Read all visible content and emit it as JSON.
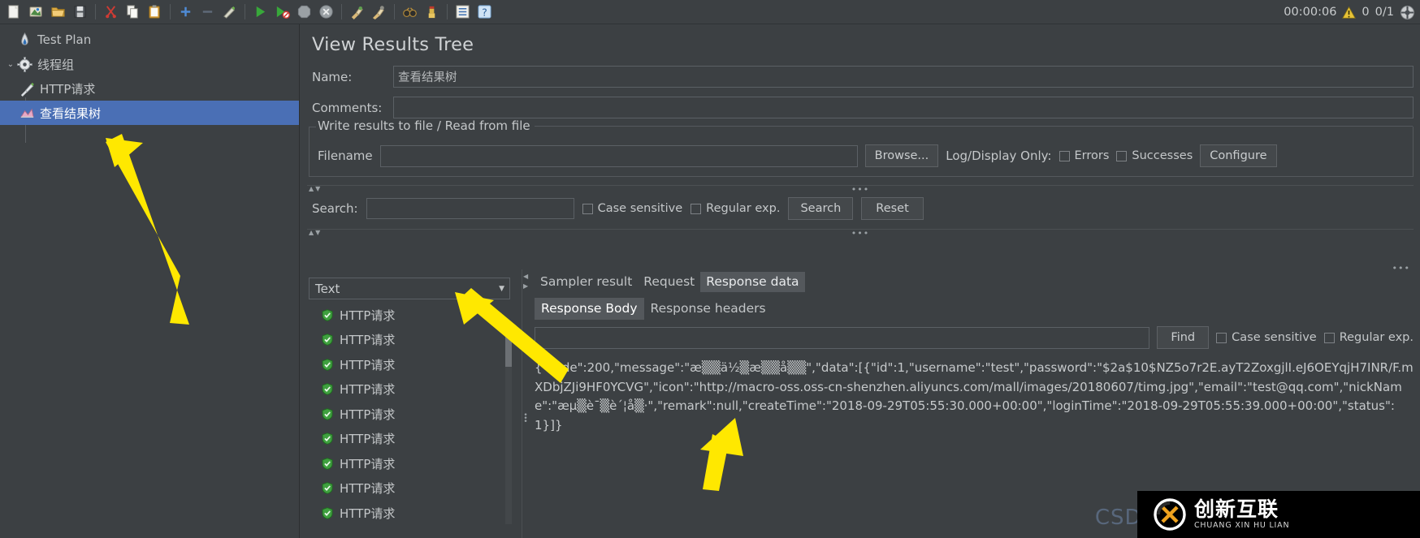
{
  "toolbar": {
    "buttons": [
      {
        "name": "new-icon",
        "glyph": "📄",
        "title": "New"
      },
      {
        "name": "templates-icon",
        "glyph": "🗂",
        "title": "Templates"
      },
      {
        "name": "open-icon",
        "glyph": "📂",
        "title": "Open"
      },
      {
        "name": "save-icon",
        "glyph": "💾",
        "title": "Save"
      },
      {
        "name": "cut-icon",
        "glyph": "✂",
        "title": "Cut"
      },
      {
        "name": "copy-icon",
        "glyph": "📋",
        "title": "Copy"
      },
      {
        "name": "paste-icon",
        "glyph": "📋",
        "title": "Paste"
      },
      {
        "name": "expand-all-icon",
        "glyph": "+",
        "title": "Expand All"
      },
      {
        "name": "collapse-all-icon",
        "glyph": "−",
        "title": "Collapse All"
      },
      {
        "name": "toggle-icon",
        "glyph": "✎",
        "title": "Toggle"
      },
      {
        "name": "start-icon",
        "glyph": "▶",
        "title": "Start"
      },
      {
        "name": "start-no-pauses-icon",
        "glyph": "▶",
        "title": "Start no pauses"
      },
      {
        "name": "stop-icon",
        "glyph": "⬣",
        "title": "Stop"
      },
      {
        "name": "shutdown-icon",
        "glyph": "✕",
        "title": "Shutdown"
      },
      {
        "name": "clear-icon",
        "glyph": "🧹",
        "title": "Clear"
      },
      {
        "name": "clear-all-icon",
        "glyph": "🧹",
        "title": "Clear All"
      },
      {
        "name": "search-icon",
        "glyph": "🔍",
        "title": "Search"
      },
      {
        "name": "search-reset-icon",
        "glyph": "🧹",
        "title": "Reset Search"
      },
      {
        "name": "function-helper-icon",
        "glyph": "≡",
        "title": "Function Helper"
      },
      {
        "name": "help-icon",
        "glyph": "?",
        "title": "Help"
      }
    ]
  },
  "status": {
    "elapsed": "00:00:06",
    "warnings": "0",
    "threads": "0/1"
  },
  "tree": {
    "nodes": [
      {
        "label": "Test Plan",
        "icon": "test-plan-icon",
        "level": 1,
        "selected": false,
        "twisty": ""
      },
      {
        "label": "线程组",
        "icon": "thread-group-icon",
        "level": 1,
        "selected": false,
        "twisty": "⌄"
      },
      {
        "label": "HTTP请求",
        "icon": "http-request-icon",
        "level": 2,
        "selected": false,
        "twisty": ""
      },
      {
        "label": "查看结果树",
        "icon": "view-results-tree-icon",
        "level": 2,
        "selected": true,
        "twisty": ""
      }
    ]
  },
  "panel": {
    "title": "View Results Tree",
    "name_label": "Name:",
    "name_value": "查看结果树",
    "comments_label": "Comments:",
    "comments_value": "",
    "file_group_legend": "Write results to file / Read from file",
    "filename_label": "Filename",
    "filename_value": "",
    "browse_label": "Browse...",
    "log_display_label": "Log/Display Only:",
    "errors_label": "Errors",
    "errors_checked": false,
    "successes_label": "Successes",
    "successes_checked": false,
    "configure_label": "Configure"
  },
  "search": {
    "label": "Search:",
    "value": "",
    "case_sensitive_label": "Case sensitive",
    "case_sensitive_checked": false,
    "regular_exp_label": "Regular exp.",
    "regular_exp_checked": false,
    "search_button": "Search",
    "reset_button": "Reset"
  },
  "results": {
    "render_selected": "Text",
    "items": [
      {
        "label": "HTTP请求",
        "status": "success"
      },
      {
        "label": "HTTP请求",
        "status": "success"
      },
      {
        "label": "HTTP请求",
        "status": "success"
      },
      {
        "label": "HTTP请求",
        "status": "success"
      },
      {
        "label": "HTTP请求",
        "status": "success"
      },
      {
        "label": "HTTP请求",
        "status": "success"
      },
      {
        "label": "HTTP请求",
        "status": "success"
      },
      {
        "label": "HTTP请求",
        "status": "success"
      },
      {
        "label": "HTTP请求",
        "status": "success"
      }
    ]
  },
  "detail": {
    "tabs": [
      {
        "label": "Sampler result",
        "active": false
      },
      {
        "label": "Request",
        "active": false
      },
      {
        "label": "Response data",
        "active": true
      }
    ],
    "subtabs": [
      {
        "label": "Response Body",
        "active": true
      },
      {
        "label": "Response headers",
        "active": false
      }
    ],
    "find_value": "",
    "find_button": "Find",
    "case_sensitive_label": "Case sensitive",
    "case_sensitive_checked": false,
    "regular_exp_label": "Regular exp.",
    "regular_exp_checked": false,
    "response_body": "{\"code\":200,\"message\":\"æ▒▒ä½▒æ▒▒å▒▒\",\"data\":[{\"id\":1,\"username\":\"test\",\"password\":\"$2a$10$NZ5o7r2E.ayT2ZoxgjlI.eJ6OEYqjH7INR/F.mXDbjZJi9HF0YCVG\",\"icon\":\"http://macro-oss.oss-cn-shenzhen.aliyuncs.com/mall/images/20180607/timg.jpg\",\"email\":\"test@qq.com\",\"nickName\":\"æµ▒è¯▒è´¦å▒·\",\"remark\":null,\"createTime\":\"2018-09-29T05:55:30.000+00:00\",\"loginTime\":\"2018-09-29T05:55:39.000+00:00\",\"status\":1}]}"
  },
  "watermark": {
    "csdn": "CSDN",
    "brand_cn": "创新互联",
    "brand_en": "CHUANG XIN HU LIAN"
  }
}
